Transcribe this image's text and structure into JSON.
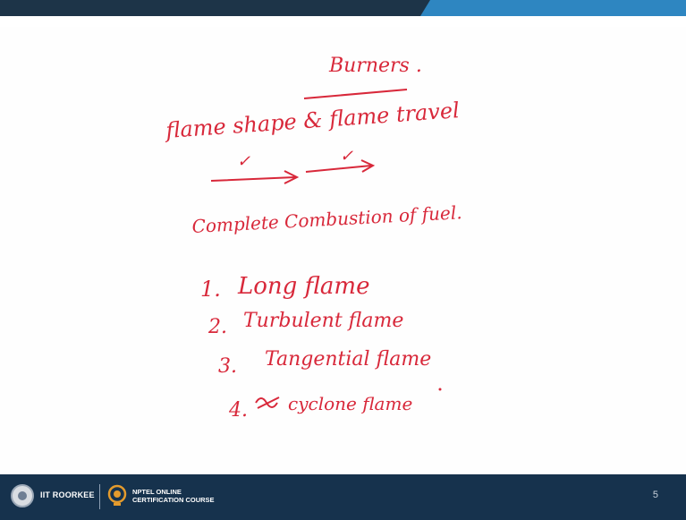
{
  "slide": {
    "title": "Burners .",
    "subtitle": "flame shape & flame travel",
    "check_marks": [
      "✓",
      "✓"
    ],
    "statement": "Complete Combustion of fuel.",
    "list": [
      {
        "number": "1.",
        "text": "Long flame"
      },
      {
        "number": "2.",
        "text": "Turbulent flame"
      },
      {
        "number": "3.",
        "text": "Tangential flame"
      },
      {
        "number": "4.",
        "text": "cyclone flame"
      }
    ]
  },
  "footer": {
    "iitr_label": "IIT ROORKEE",
    "nptel_line1": "NPTEL ONLINE",
    "nptel_line2": "CERTIFICATION COURSE",
    "page_number": "5"
  },
  "colors": {
    "ink": "#d8283a",
    "top_bar_dark": "#1d3448",
    "top_bar_accent": "#2e86c1",
    "footer": "#16324d"
  }
}
